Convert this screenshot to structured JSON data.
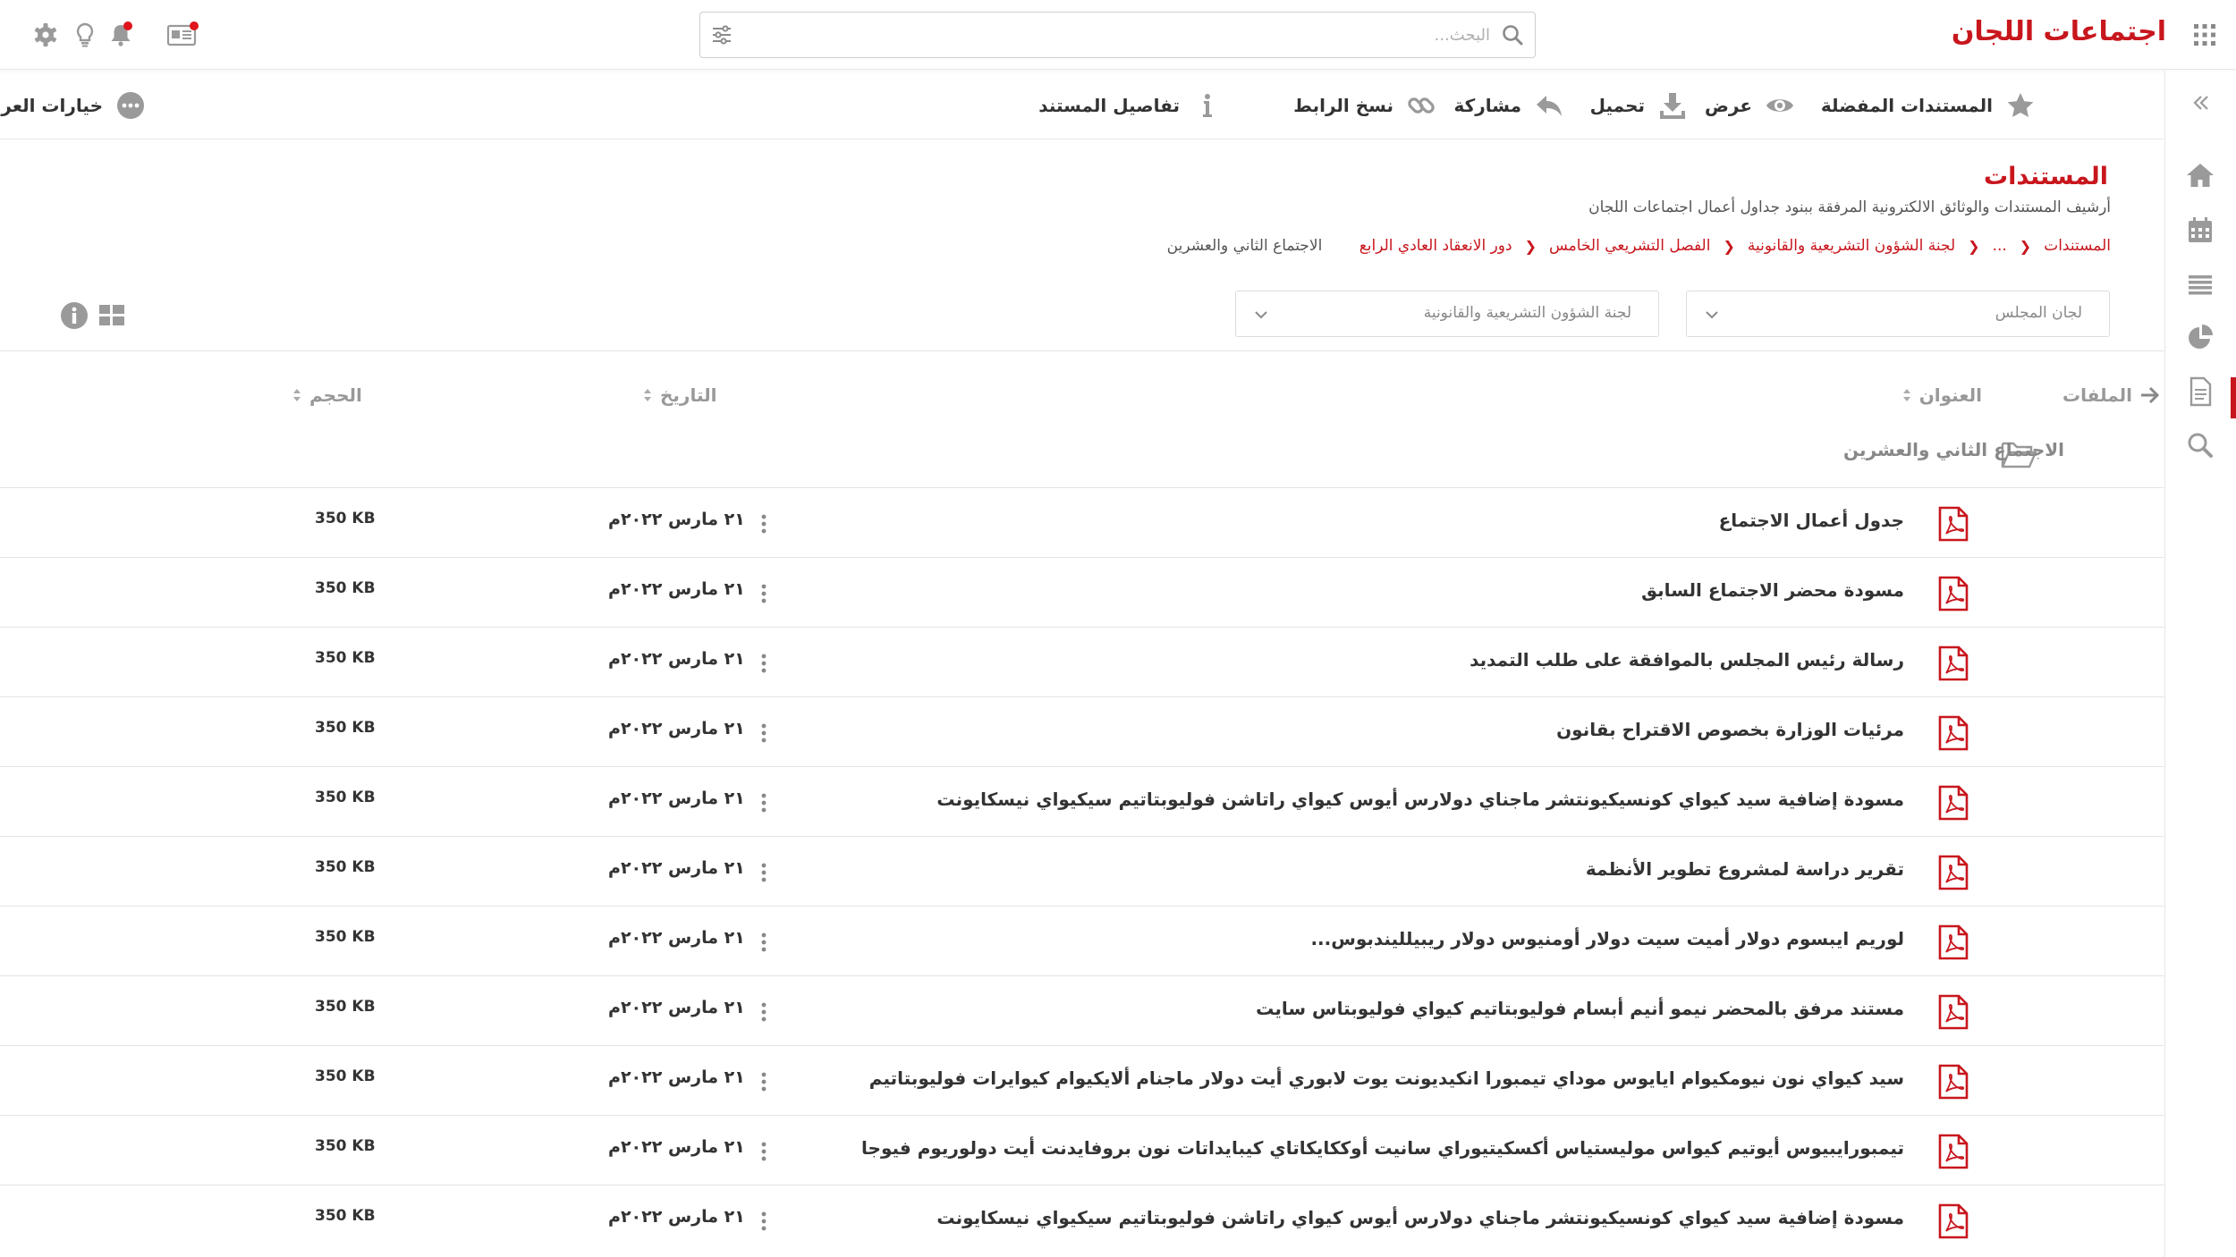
{
  "app": {
    "title": "اجتماعات اللجان"
  },
  "search": {
    "placeholder": "البحث..."
  },
  "toolbar": {
    "favorites": "المستندات المفضلة",
    "view": "عرض",
    "download": "تحميل",
    "share": "مشاركة",
    "copy_link": "نسخ الرابط",
    "details": "تفاصيل المستند",
    "view_options": "خيارات العرض"
  },
  "page": {
    "title": "المستندات",
    "subtitle": "أرشيف المستندات والوثائق الالكترونية المرفقة ببنود جداول أعمال اجتماعات اللجان"
  },
  "breadcrumb": [
    "المستندات",
    "...",
    "لجنة الشؤون التشريعية والقانونية",
    "الفصل التشريعي الخامس",
    "دور الانعقاد العادي الرابع",
    "الاجتماع الثاني والعشرين"
  ],
  "filters": {
    "council": "لجان المجلس",
    "committee": "لجنة الشؤون التشريعية والقانونية"
  },
  "table": {
    "headers": {
      "files": "الملفات",
      "title": "العنوان",
      "date": "التاريخ",
      "size": "الحجم"
    },
    "folder": "الاجتماع الثاني والعشرين",
    "rows": [
      {
        "title": "جدول أعمال الاجتماع",
        "date": "٢١ مارس ٢٠٢٢م",
        "size": "350 KB"
      },
      {
        "title": "مسودة محضر الاجتماع السابق",
        "date": "٢١ مارس ٢٠٢٢م",
        "size": "350 KB"
      },
      {
        "title": "رسالة رئيس المجلس بالموافقة على طلب التمديد",
        "date": "٢١ مارس ٢٠٢٢م",
        "size": "350 KB"
      },
      {
        "title": "مرئيات الوزارة بخصوص الاقتراح بقانون",
        "date": "٢١ مارس ٢٠٢٢م",
        "size": "350 KB"
      },
      {
        "title": "مسودة إضافية سيد كيواي كونسيكيونتشر ماجناي دولارس أيوس كيواي راتاشن فوليوبتاتيم سيكيواي نيسكايونت",
        "date": "٢١ مارس ٢٠٢٢م",
        "size": "350 KB"
      },
      {
        "title": "تقرير دراسة لمشروع تطوير الأنظمة",
        "date": "٢١ مارس ٢٠٢٢م",
        "size": "350 KB"
      },
      {
        "title": "لوريم ايبسوم دولار أميت سيت دولار أومنيوس دولار ريبيلليندبوس...",
        "date": "٢١ مارس ٢٠٢٢م",
        "size": "350 KB"
      },
      {
        "title": "مستند مرفق بالمحضر نيمو أنيم أبسام فوليوبتاتيم كيواي فوليوبتاس سايت",
        "date": "٢١ مارس ٢٠٢٢م",
        "size": "350 KB"
      },
      {
        "title": "سيد كيواي نون نيومكيوام ايايوس موداي تيمبورا انكيديونت يوت لابوري أيت دولار ماجنام ألايكيوام كيوايرات فوليوبتاتيم",
        "date": "٢١ مارس ٢٠٢٢م",
        "size": "350 KB"
      },
      {
        "title": "تيمبورايبيوس أيوتيم كيواس موليستياس أكسكيتيوراي سانيت أوككايكاتاي كيبايداتات نون بروفايدنت أيت دولوريوم فيوجا",
        "date": "٢١ مارس ٢٠٢٢م",
        "size": "350 KB"
      },
      {
        "title": "مسودة إضافية سيد كيواي كونسيكيونتشر ماجناي دولارس أيوس كيواي راتاشن فوليوبتاتيم سيكيواي نيسكايونت",
        "date": "٢١ مارس ٢٠٢٢م",
        "size": "350 KB"
      }
    ]
  },
  "colors": {
    "brand": "#c8161d",
    "icon_gray": "#9a9a9a",
    "notification": "#e0141c"
  },
  "icons": [
    "apps-grid-icon",
    "search-icon",
    "filter-icon",
    "settings-icon",
    "lightbulb-icon",
    "bell-icon",
    "news-icon",
    "star-icon",
    "eye-icon",
    "download-icon",
    "reply-icon",
    "link-icon",
    "info-icon",
    "more-icon",
    "chevron-down-icon",
    "grid-view-icon",
    "info-circle-icon",
    "arrow-right-icon",
    "folder-open-icon",
    "pdf-icon",
    "kebab-menu-icon",
    "home-icon",
    "calendar-icon",
    "list-icon",
    "pie-chart-icon",
    "document-icon",
    "magnifier-icon",
    "collapse-icon"
  ]
}
